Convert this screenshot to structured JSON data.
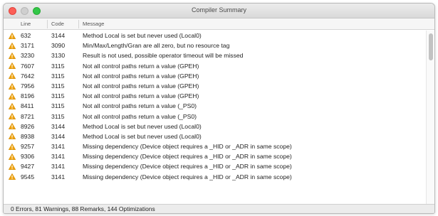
{
  "window": {
    "title": "Compiler Summary"
  },
  "columns": {
    "line": "Line",
    "code": "Code",
    "message": "Message"
  },
  "rows": [
    {
      "line": "632",
      "code": "3144",
      "message": "Method Local is set but never used (Local0)"
    },
    {
      "line": "3171",
      "code": "3090",
      "message": "Min/Max/Length/Gran are all zero, but no resource tag"
    },
    {
      "line": "3230",
      "code": "3130",
      "message": "Result is not used, possible operator timeout will be missed"
    },
    {
      "line": "7607",
      "code": "3115",
      "message": "Not all control paths return a value (GPEH)"
    },
    {
      "line": "7642",
      "code": "3115",
      "message": "Not all control paths return a value (GPEH)"
    },
    {
      "line": "7956",
      "code": "3115",
      "message": "Not all control paths return a value (GPEH)"
    },
    {
      "line": "8196",
      "code": "3115",
      "message": "Not all control paths return a value (GPEH)"
    },
    {
      "line": "8411",
      "code": "3115",
      "message": "Not all control paths return a value (_PS0)"
    },
    {
      "line": "8721",
      "code": "3115",
      "message": "Not all control paths return a value (_PS0)"
    },
    {
      "line": "8926",
      "code": "3144",
      "message": "Method Local is set but never used (Local0)"
    },
    {
      "line": "8938",
      "code": "3144",
      "message": "Method Local is set but never used (Local0)"
    },
    {
      "line": "9257",
      "code": "3141",
      "message": "Missing dependency (Device object requires a _HID or _ADR in same scope)"
    },
    {
      "line": "9306",
      "code": "3141",
      "message": "Missing dependency (Device object requires a _HID or _ADR in same scope)"
    },
    {
      "line": "9427",
      "code": "3141",
      "message": "Missing dependency (Device object requires a _HID or _ADR in same scope)"
    },
    {
      "line": "9545",
      "code": "3141",
      "message": "Missing dependency (Device object requires a _HID or _ADR in same scope)"
    }
  ],
  "status": {
    "summary": "0 Errors, 81 Warnings, 88 Remarks, 144 Optimizations"
  },
  "icons": {
    "row_icon": "warning-icon"
  },
  "colors": {
    "warning": "#f0a20a",
    "close": "#fc5f57",
    "maximize": "#33c748"
  }
}
